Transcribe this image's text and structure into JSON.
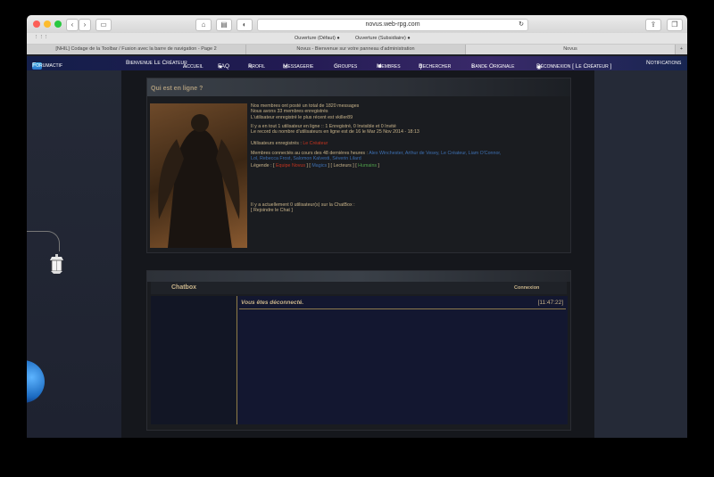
{
  "browser": {
    "address": "novus.web-rpg.com"
  },
  "bookmarks": {
    "items": [
      "Ouverture (Défaut) ●",
      "Ouverture (Subsidiaire) ●"
    ]
  },
  "tabs": [
    {
      "label": "[NHIL] Codage de la Toolbar / Fusion avec la barre de navigation - Page 2"
    },
    {
      "label": "Novus - Bienvenue sur votre panneau d'administration"
    },
    {
      "label": "Novus"
    }
  ],
  "nav": {
    "logo": "Forumactif",
    "welcome": "Bienvenue Le Créateur",
    "items": [
      "Accueil",
      "FAQ",
      "Profil",
      "Messagerie",
      "Groupes",
      "Membres",
      "Rechercher",
      "Bande Originale",
      "Déconnexion [ Le Créateur ]"
    ],
    "notifications": "Notifications"
  },
  "whoisonline": {
    "title": "Qui est en ligne ?",
    "line1": "Nos membres ont posté un total de 1820 messages",
    "line2": "Nous avons 33 membres enregistrés",
    "line3": "L'utilisateur enregistré le plus récent est vkiller89",
    "line4": "Il y a en tout 1 utilisateur en ligne :: 1 Enregistré, 0 Invisible et 0 Invité",
    "line5": "Le record du nombre d'utilisateurs en ligne est de 16 le Mar 25 Nov 2014 - 18:13",
    "registered_label": "Utilisateurs enregistrés :",
    "registered_user": "Le Créateur",
    "connected_label": "Membres connectés au cours des 48 dernières heures :",
    "connected_users_1": "Alex Winchester, Arthur de Vesey, Le Créateur, Liam O'Connor,",
    "connected_users_2": "Lol, Rebecca Frost, Salomon Kalvesti, Séverin Lilard",
    "legend_label": "Légende :",
    "legend_1": "Equipe Novus",
    "legend_2": "Magics",
    "legend_3": "Lecteurs",
    "legend_4": "Humains",
    "chatbox_line": "Il y a actuellement 0 utilisateur(s) sur la ChatBox :",
    "join_chat": "[ Rejoindre le Chat ]"
  },
  "chatbox": {
    "title": "Chatbox",
    "connect": "Connexion",
    "message": "Vous êtes déconnecté.",
    "time": "[11:47:22]"
  }
}
